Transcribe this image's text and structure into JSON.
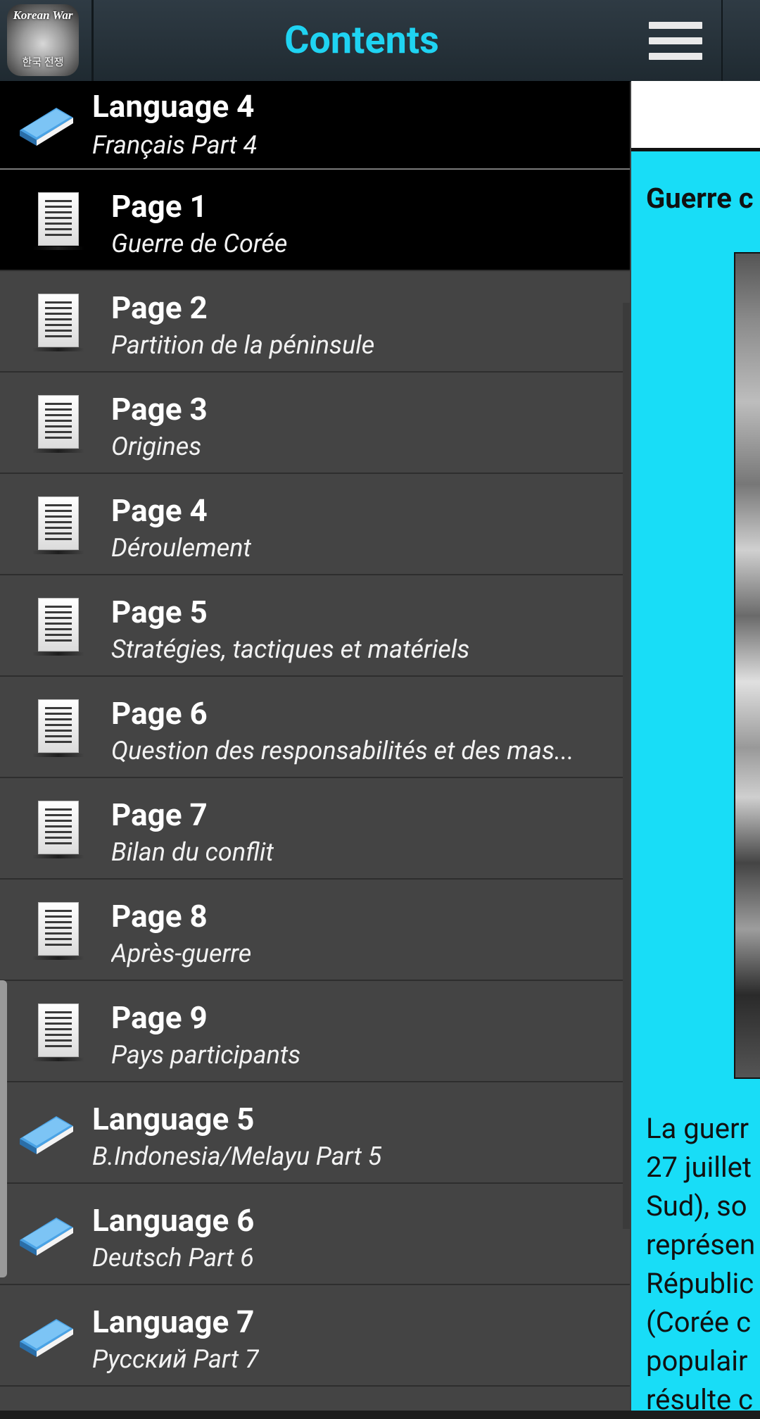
{
  "drawer": {
    "title": "Contents",
    "app_icon": {
      "label": "Korean War",
      "sub_label": "한국 전쟁"
    },
    "items": [
      {
        "kind": "language",
        "title": "Language 4",
        "subtitle": "Français Part 4",
        "selected": true
      },
      {
        "kind": "page",
        "title": "Page 1",
        "subtitle": "Guerre de Corée",
        "selected": true
      },
      {
        "kind": "page",
        "title": "Page 2",
        "subtitle": "Partition de la péninsule"
      },
      {
        "kind": "page",
        "title": "Page 3",
        "subtitle": "Origines"
      },
      {
        "kind": "page",
        "title": "Page 4",
        "subtitle": "Déroulement"
      },
      {
        "kind": "page",
        "title": "Page 5",
        "subtitle": "Stratégies, tactiques et matériels"
      },
      {
        "kind": "page",
        "title": "Page 6",
        "subtitle": "Question des responsabilités et des mas..."
      },
      {
        "kind": "page",
        "title": "Page 7",
        "subtitle": "Bilan du conflit"
      },
      {
        "kind": "page",
        "title": "Page 8",
        "subtitle": "Après-guerre"
      },
      {
        "kind": "page",
        "title": "Page 9",
        "subtitle": "Pays participants"
      },
      {
        "kind": "language",
        "title": "Language 5",
        "subtitle": "B.Indonesia/Melayu Part 5"
      },
      {
        "kind": "language",
        "title": "Language 6",
        "subtitle": "Deutsch Part 6"
      },
      {
        "kind": "language",
        "title": "Language 7",
        "subtitle": "Русский Part 7"
      }
    ]
  },
  "content": {
    "article_title": "Guerre c",
    "body_lines": [
      "La guerr",
      "27 juillet",
      "Sud), so",
      "représen",
      "Républic",
      "(Corée c",
      "populair",
      "résulte c"
    ]
  },
  "icons": {
    "menu": "hamburger-menu-icon",
    "page": "document-icon",
    "language": "book-icon"
  },
  "colors": {
    "title_accent": "#1fd3f2",
    "content_background": "#18ddf7",
    "drawer_background": "#444444",
    "selected_row": "#000000"
  }
}
